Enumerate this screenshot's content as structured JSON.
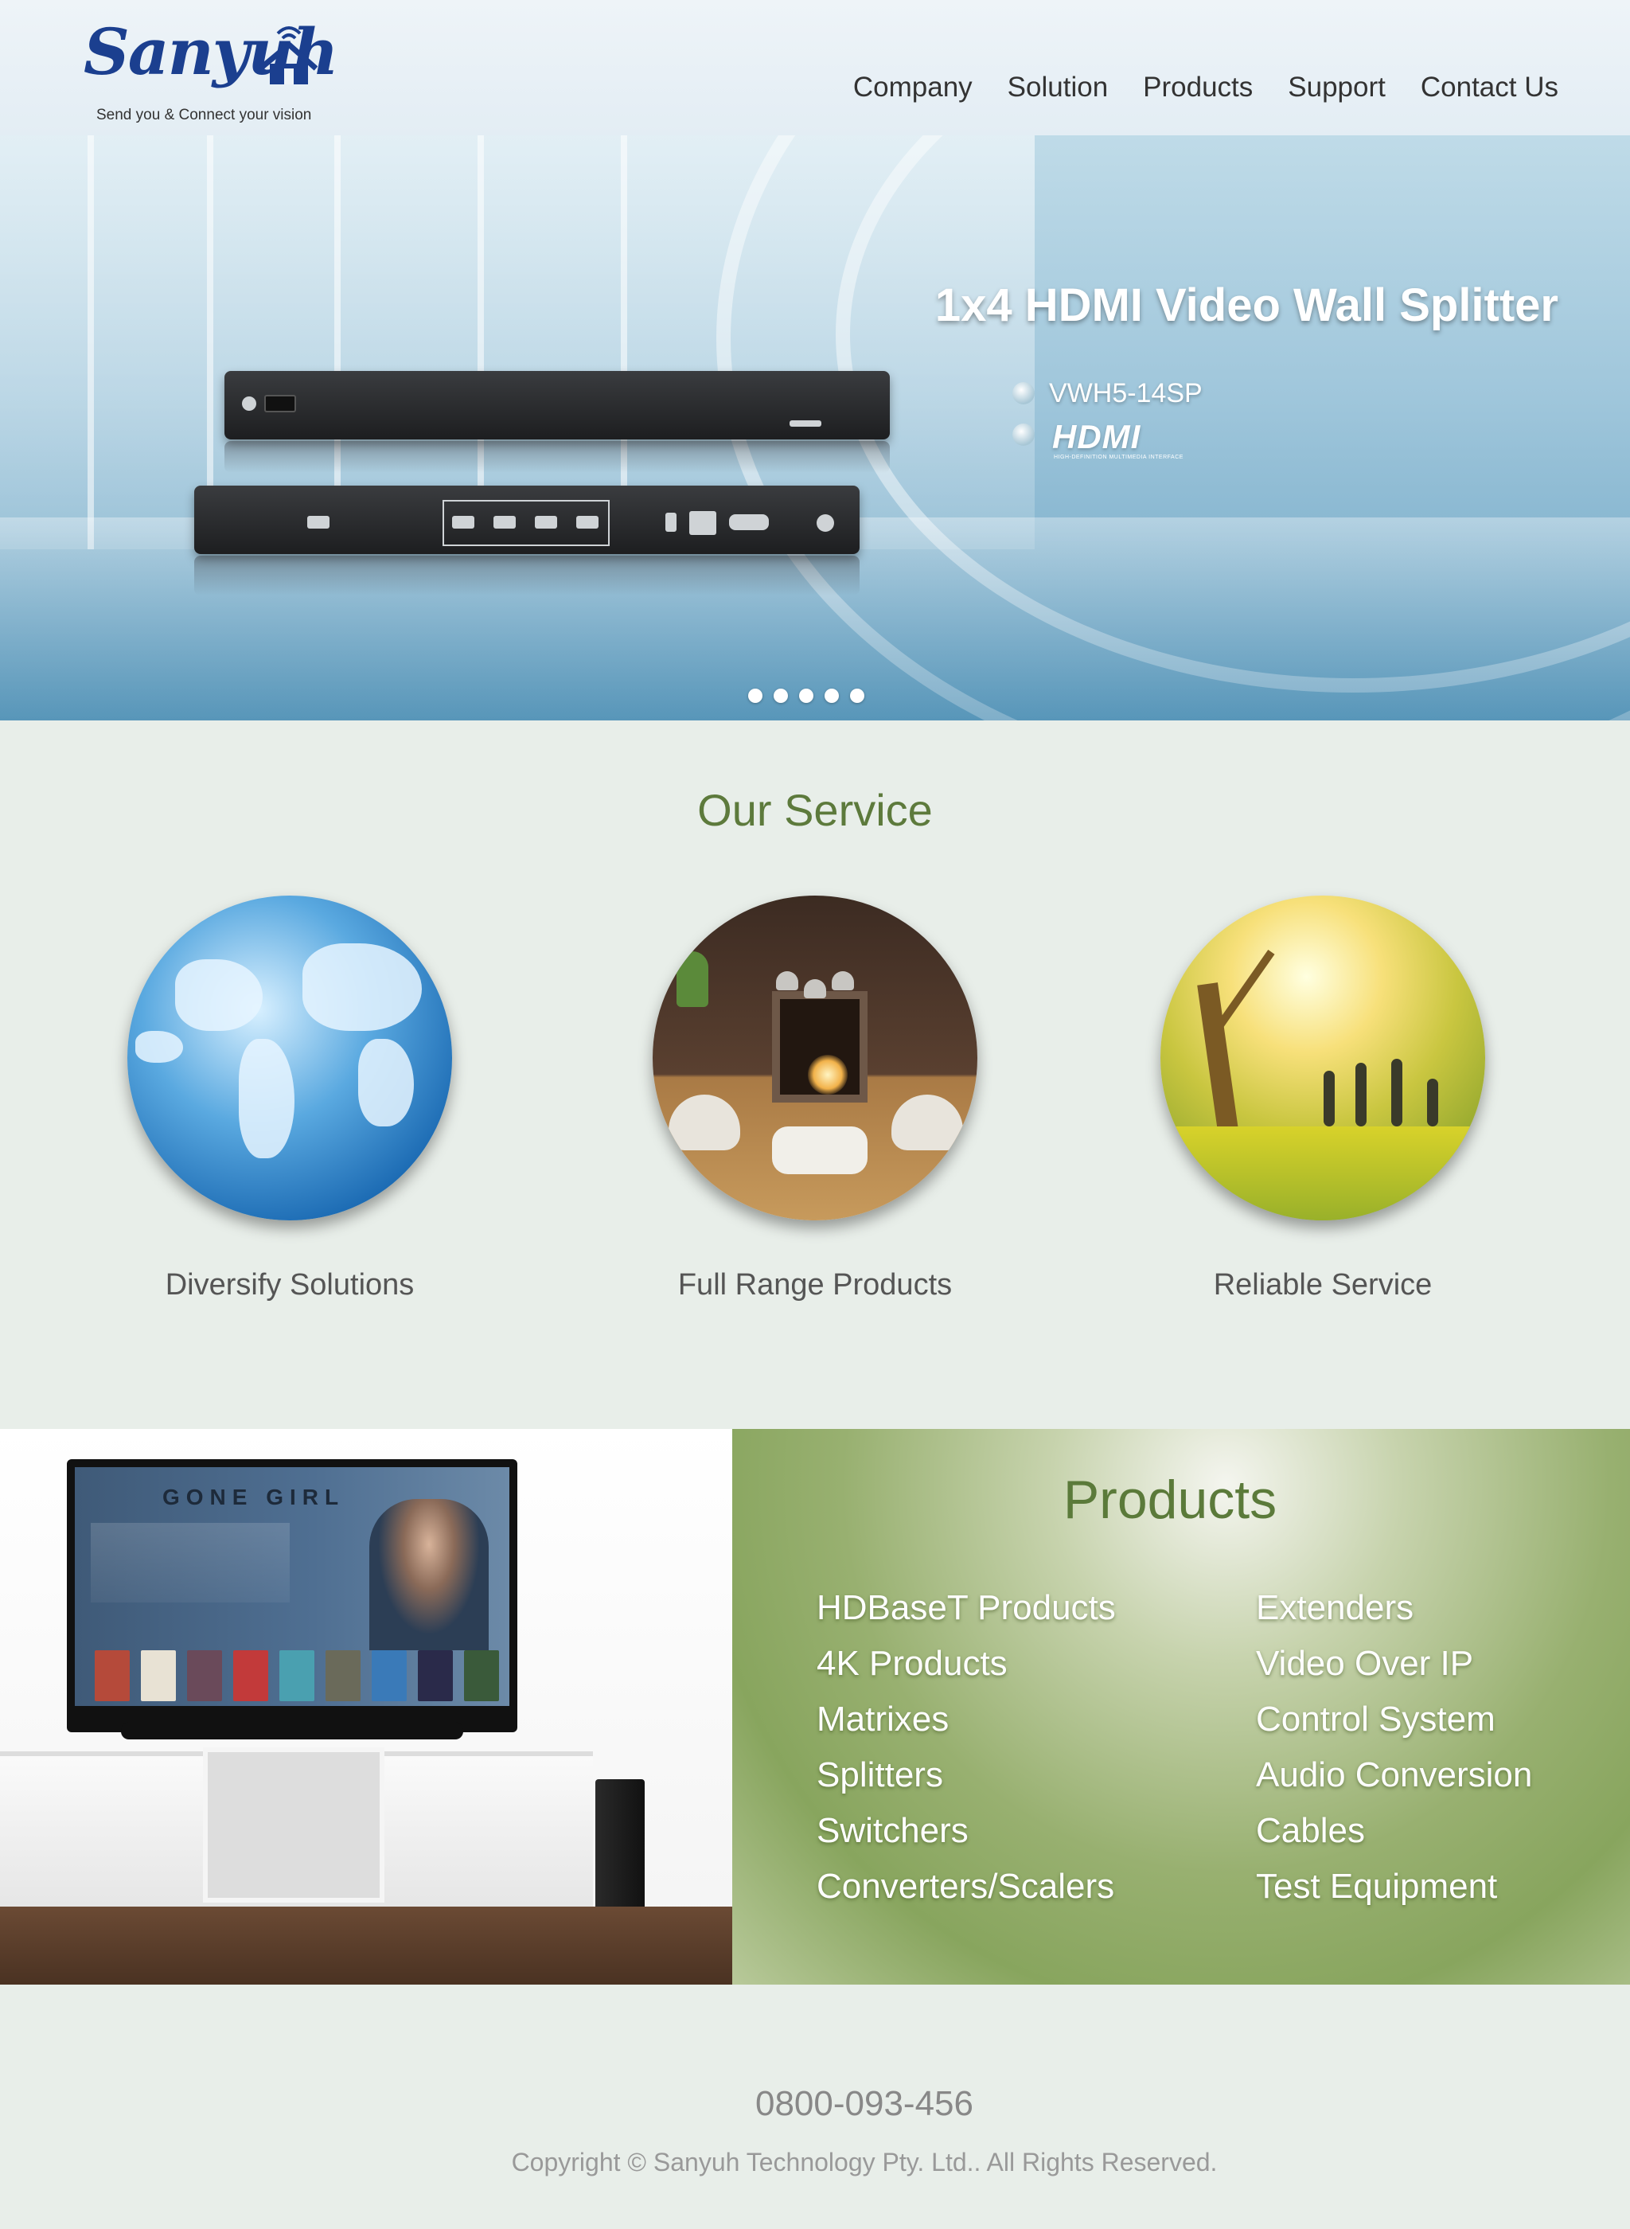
{
  "header": {
    "logo_text": "Sanyuh",
    "tagline": "Send you & Connect your vision",
    "nav": [
      "Company",
      "Solution",
      "Products",
      "Support",
      "Contact Us"
    ]
  },
  "hero": {
    "title": "1x4 HDMI Video Wall Splitter",
    "model": "VWH5-14SP",
    "hdmi_logo": "HDMI",
    "hdmi_sub": "HIGH-DEFINITION MULTIMEDIA INTERFACE",
    "slide_count": 5
  },
  "service": {
    "title": "Our Service",
    "cards": [
      {
        "label": "Diversify Solutions",
        "image": "globe"
      },
      {
        "label": "Full Range Products",
        "image": "living-room"
      },
      {
        "label": "Reliable Service",
        "image": "park-family"
      }
    ]
  },
  "tv": {
    "screen_title": "GONE GIRL"
  },
  "products": {
    "title": "Products",
    "left": [
      "HDBaseT Products",
      "4K Products",
      "Matrixes",
      "Splitters",
      "Switchers",
      "Converters/Scalers"
    ],
    "right": [
      "Extenders",
      "Video Over IP",
      "Control System",
      "Audio Conversion",
      "Cables",
      "Test Equipment"
    ]
  },
  "footer": {
    "phone": "0800-093-456",
    "copyright": "Copyright © Sanyuh Technology Pty. Ltd.. All Rights Reserved."
  },
  "colors": {
    "brand_blue": "#1b3f8f",
    "service_green": "#5d7a3c",
    "page_bg": "#e8eee9"
  }
}
